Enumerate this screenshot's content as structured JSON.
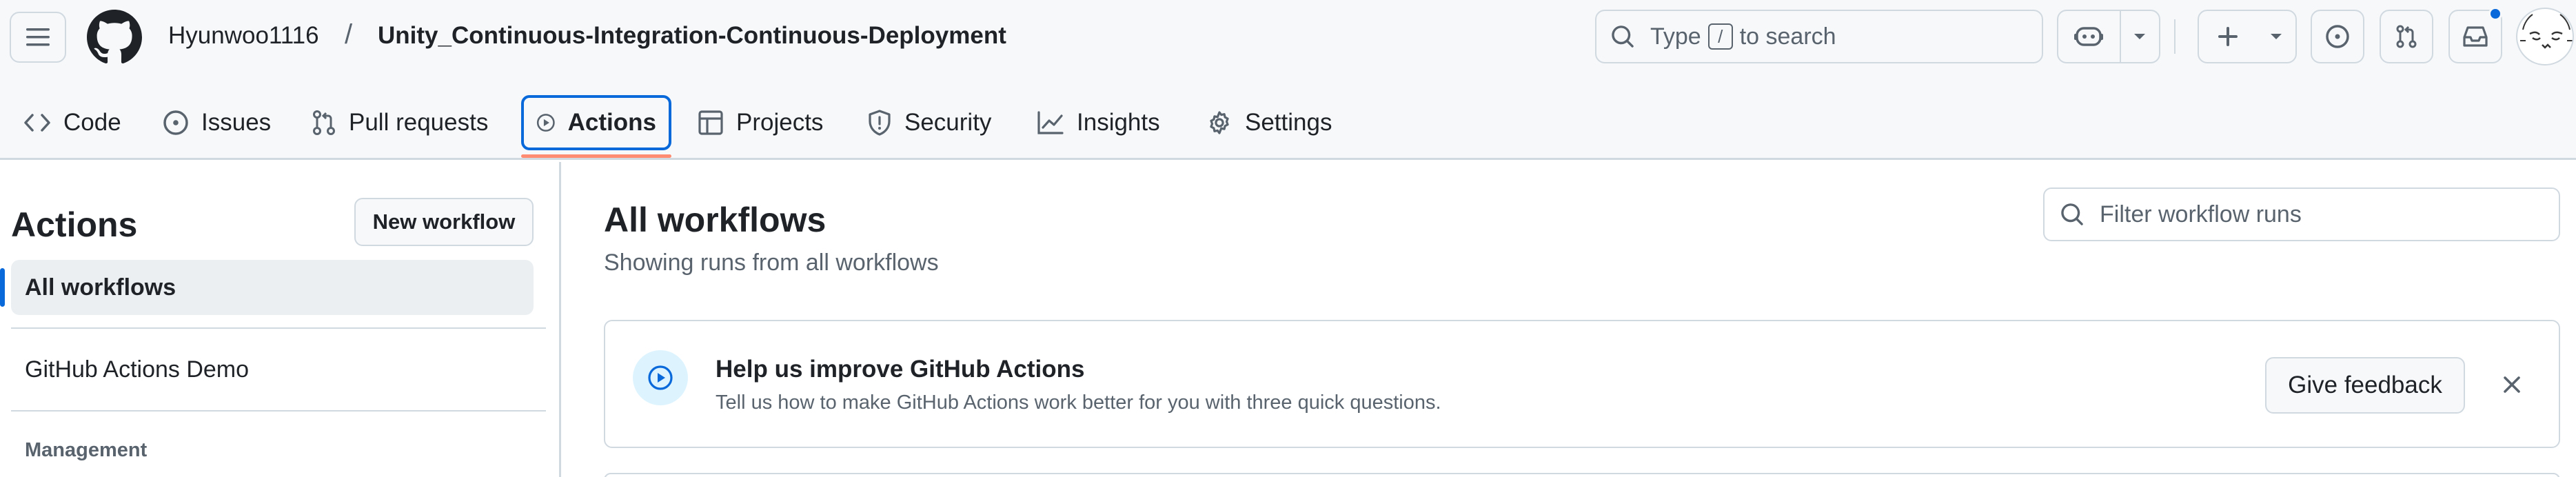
{
  "header": {
    "owner": "Hyunwoo1116",
    "separator": "/",
    "repo": "Unity_Continuous-Integration-Continuous-Deployment",
    "search": {
      "prefix": "Type",
      "key": "/",
      "suffix": "to search"
    }
  },
  "tabs": [
    {
      "label": "Code",
      "icon": "code-icon"
    },
    {
      "label": "Issues",
      "icon": "issue-opened-icon"
    },
    {
      "label": "Pull requests",
      "icon": "git-pull-request-icon"
    },
    {
      "label": "Actions",
      "icon": "play-icon",
      "active": true
    },
    {
      "label": "Projects",
      "icon": "table-icon"
    },
    {
      "label": "Security",
      "icon": "shield-icon"
    },
    {
      "label": "Insights",
      "icon": "graph-icon"
    },
    {
      "label": "Settings",
      "icon": "gear-icon"
    }
  ],
  "sidebar": {
    "title": "Actions",
    "new_workflow": "New workflow",
    "items": [
      {
        "label": "All workflows",
        "active": true
      },
      {
        "label": "GitHub Actions Demo"
      }
    ],
    "section": "Management"
  },
  "main": {
    "title": "All workflows",
    "subtitle": "Showing runs from all workflows",
    "filter_placeholder": "Filter workflow runs"
  },
  "banner": {
    "title": "Help us improve GitHub Actions",
    "text": "Tell us how to make GitHub Actions work better for you with three quick questions.",
    "button": "Give feedback"
  },
  "colors": {
    "accent": "#0969da",
    "tab_underline": "#fd8c73",
    "border": "#d1d9e0",
    "header_bg": "#f6f8fa"
  }
}
